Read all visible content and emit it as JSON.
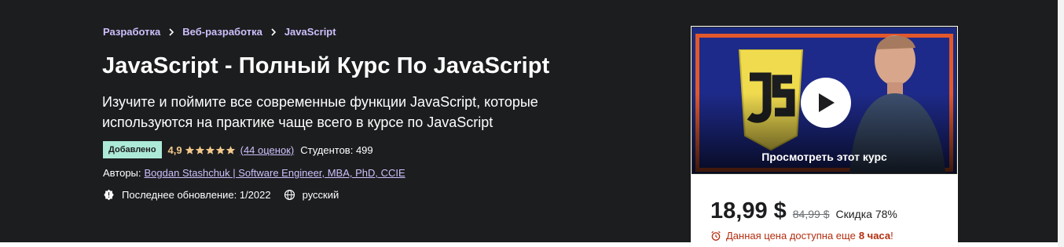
{
  "breadcrumb": {
    "items": [
      {
        "label": "Разработка"
      },
      {
        "label": "Веб-разработка"
      },
      {
        "label": "JavaScript"
      }
    ],
    "separator_icon": "chevron-right-icon"
  },
  "course": {
    "title": "JavaScript - Полный Курс По JavaScript",
    "subtitle": "Изучите и поймите все современные функции JavaScript, которые используются на практике чаще всего в курсе по JavaScript",
    "badge": "Добавлено",
    "rating": "4,9",
    "stars": 5,
    "reviews": "(44 оценок)",
    "students": "Студентов: 499",
    "authors_label": "Авторы:",
    "authors_link": "Bogdan Stashchuk | Software Engineer, MBA, PhD, CCIE",
    "last_update": "Последнее обновление: 1/2022",
    "language": "русский"
  },
  "card": {
    "preview_label": "Просмотреть этот курс",
    "price": "18,99 $",
    "old_price": "84,99 $",
    "discount": "Скидка 78%",
    "timer_text": "Данная цена доступна еще",
    "timer_bold": "8 часа",
    "timer_suffix": "!"
  },
  "colors": {
    "hero_bg": "#1c1d1f",
    "link_purple": "#cec0fc",
    "star_gold": "#f3ca8c",
    "badge_bg": "#acead7",
    "alert_red": "#b32d0f"
  },
  "icons": {
    "star": "star-icon",
    "update": "alert-badge-icon",
    "language": "globe-icon",
    "play": "play-icon",
    "timer": "alarm-clock-icon"
  }
}
